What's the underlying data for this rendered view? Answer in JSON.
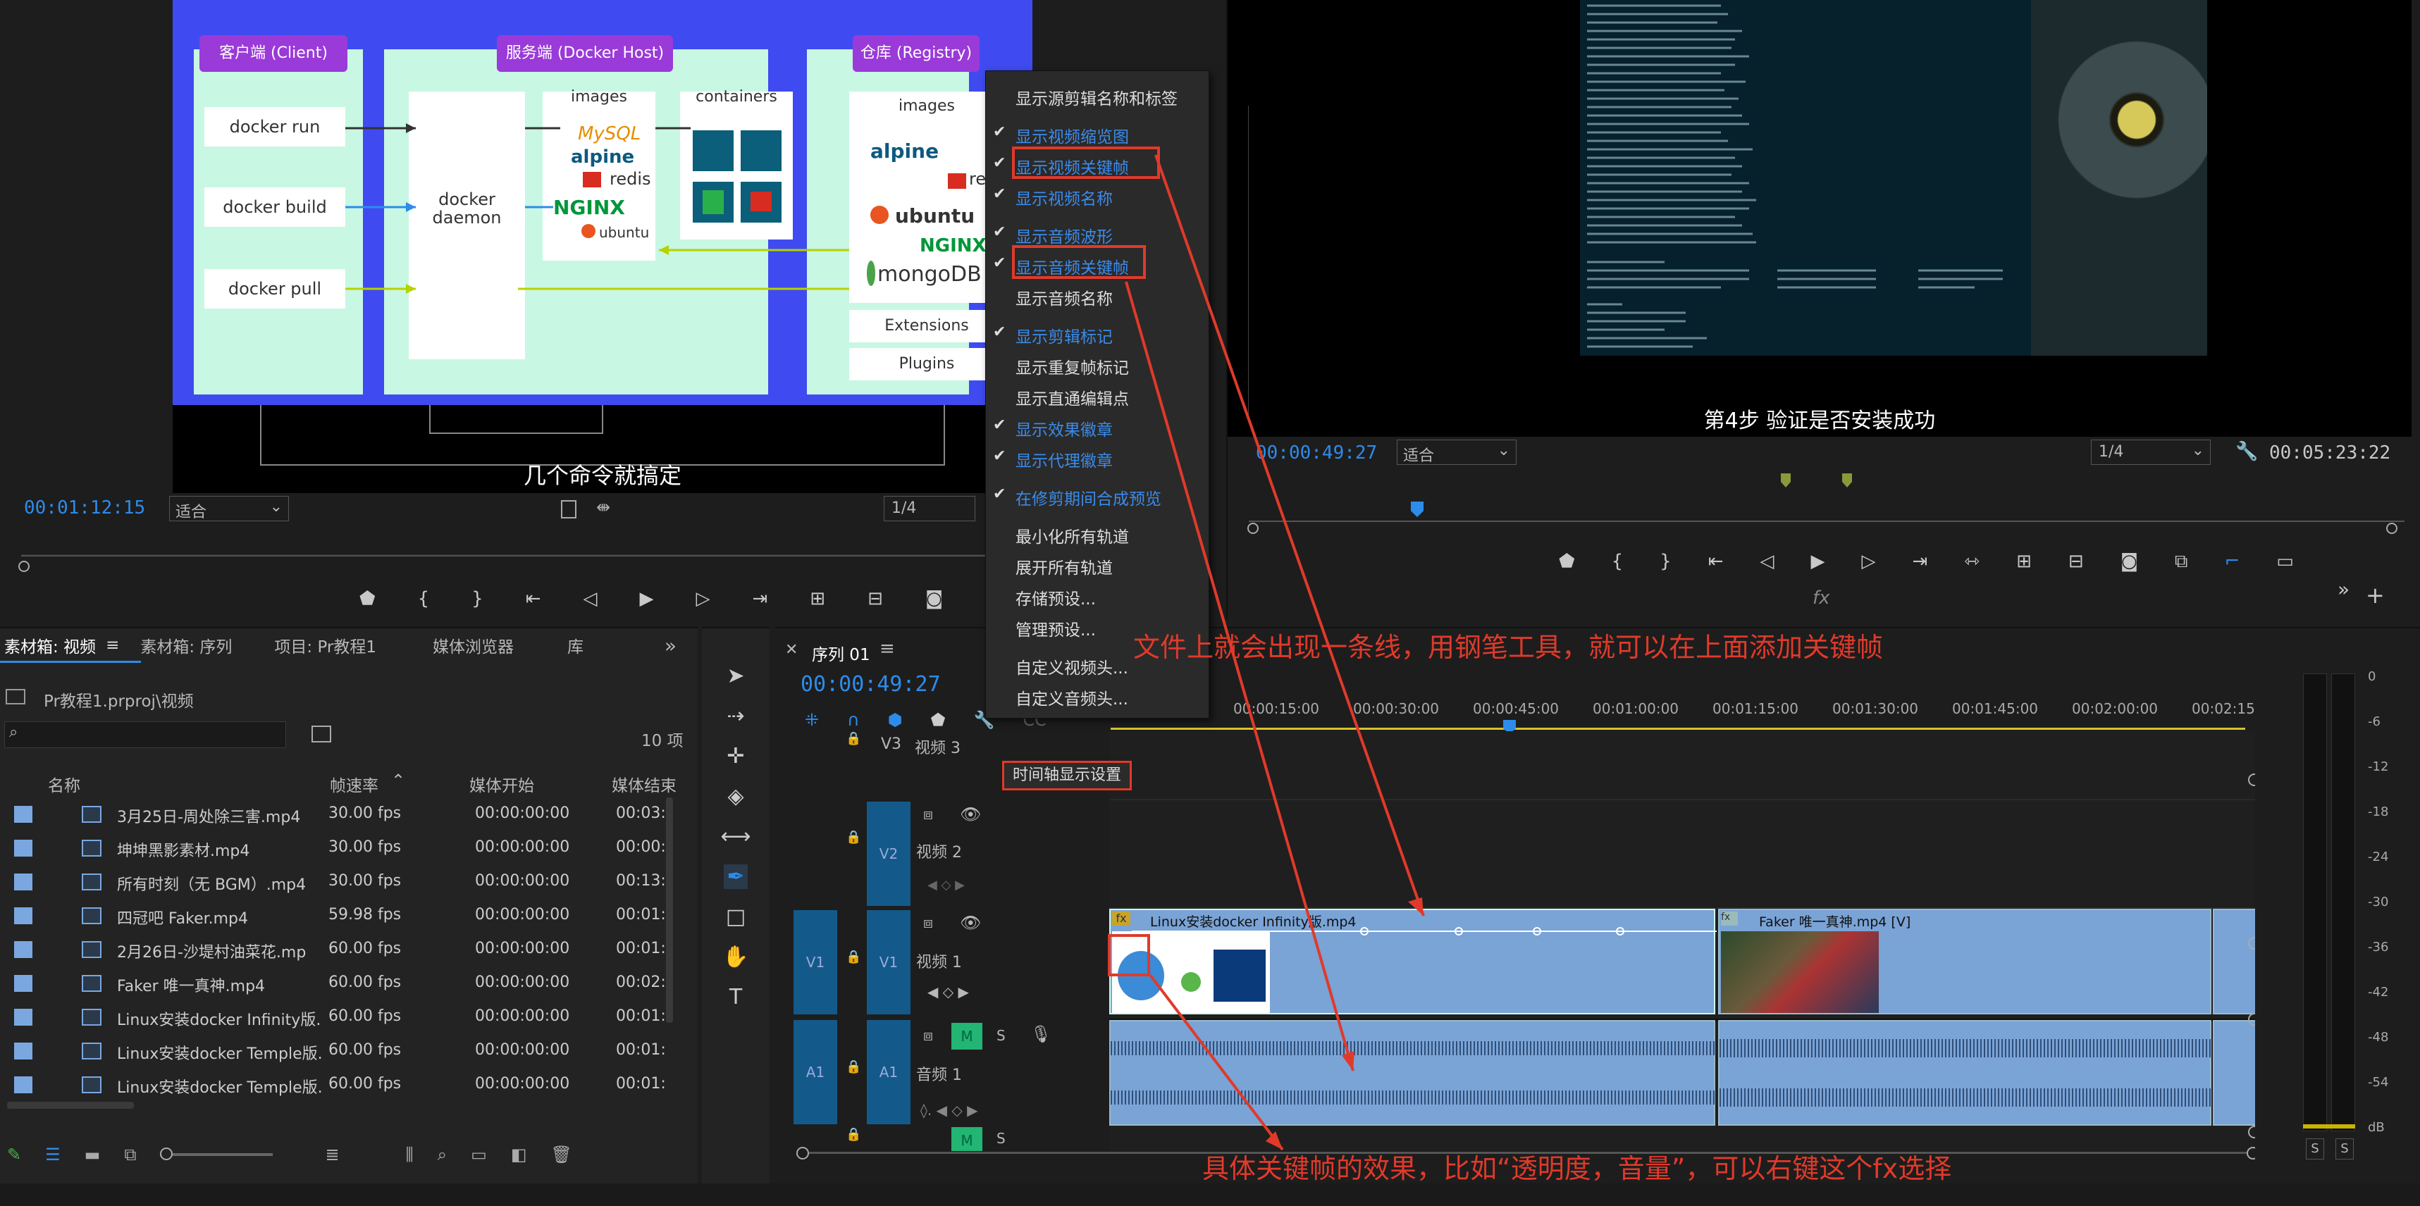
{
  "source_monitor": {
    "timecode": "00:01:12:15",
    "fit": "适合",
    "ratio": "1/4",
    "caption": "几个命令就搞定",
    "slide": {
      "client": "客户端 (Client)",
      "host": "服务端 (Docker Host)",
      "registry": "仓库 (Registry)",
      "cmds": [
        "docker run",
        "docker build",
        "docker pull"
      ],
      "daemon": "docker\ndaemon",
      "images": "images",
      "containers": "containers",
      "reg_images": "images",
      "logos_mid": [
        "MySQL",
        "alpine",
        "redis",
        "NGINX",
        "ubuntu"
      ],
      "logos_reg": [
        "alpine",
        "redis",
        "ubuntu",
        "NGINX",
        "mongoDB"
      ],
      "extensions": "Extensions",
      "plugins": "Plugins"
    }
  },
  "program_monitor": {
    "timecode": "00:00:49:27",
    "fit": "适合",
    "ratio": "1/4",
    "duration": "00:05:23:22",
    "caption": "第4步 验证是否安装成功",
    "fx": "fx"
  },
  "menu": {
    "items": [
      {
        "label": "显示源剪辑名称和标签",
        "checked": false
      },
      {
        "label": "显示视频缩览图",
        "checked": true
      },
      {
        "label": "显示视频关键帧",
        "checked": true,
        "highlight": true
      },
      {
        "label": "显示视频名称",
        "checked": true
      },
      {
        "label": "显示音频波形",
        "checked": true
      },
      {
        "label": "显示音频关键帧",
        "checked": true,
        "highlight": true
      },
      {
        "label": "显示音频名称",
        "checked": false
      },
      {
        "label": "显示剪辑标记",
        "checked": true
      },
      {
        "label": "显示重复帧标记",
        "checked": false
      },
      {
        "label": "显示直通编辑点",
        "checked": false
      },
      {
        "label": "显示效果徽章",
        "checked": true
      },
      {
        "label": "显示代理徽章",
        "checked": true
      },
      {
        "label": "在修剪期间合成预览",
        "checked": true
      },
      {
        "label": "最小化所有轨道",
        "checked": false
      },
      {
        "label": "展开所有轨道",
        "checked": false
      },
      {
        "label": "存储预设...",
        "checked": false
      },
      {
        "label": "管理预设...",
        "checked": false
      },
      {
        "label": "自定义视频头...",
        "checked": false
      },
      {
        "label": "自定义音频头...",
        "checked": false
      }
    ]
  },
  "project_panel": {
    "tabs": [
      "素材箱: 视频",
      "素材箱: 序列",
      "项目: Pr教程1",
      "媒体浏览器",
      "库"
    ],
    "path": "Pr教程1.prproj\\视频",
    "count": "10 项",
    "columns": [
      "名称",
      "帧速率",
      "媒体开始",
      "媒体结束"
    ],
    "rows": [
      {
        "name": "3月25日-周处除三害.mp4",
        "fps": "30.00 fps",
        "start": "00:00:00:00",
        "end": "00:03:"
      },
      {
        "name": "坤坤黑影素材.mp4",
        "fps": "30.00 fps",
        "start": "00:00:00:00",
        "end": "00:00:"
      },
      {
        "name": "所有时刻（无 BGM）.mp4",
        "fps": "30.00 fps",
        "start": "00:00:00:00",
        "end": "00:13:"
      },
      {
        "name": "四冠吧 Faker.mp4",
        "fps": "59.98 fps",
        "start": "00:00:00:00",
        "end": "00:01:"
      },
      {
        "name": "2月26日-沙堤村油菜花.mp",
        "fps": "60.00 fps",
        "start": "00:00:00:00",
        "end": "00:01:"
      },
      {
        "name": "Faker 唯一真神.mp4",
        "fps": "60.00 fps",
        "start": "00:00:00:00",
        "end": "00:02:"
      },
      {
        "name": "Linux安装docker Infinity版.",
        "fps": "60.00 fps",
        "start": "00:00:00:00",
        "end": "00:01:"
      },
      {
        "name": "Linux安装docker Temple版.",
        "fps": "60.00 fps",
        "start": "00:00:00:00",
        "end": "00:01:"
      },
      {
        "name": "Linux安装docker Temple版.",
        "fps": "60.00 fps",
        "start": "00:00:00:00",
        "end": "00:01:"
      }
    ]
  },
  "timeline": {
    "tab": "序列 01",
    "timecode": "00:00:49:27",
    "tooltip": "时间轴显示设置",
    "ruler": [
      "00:00",
      "00:00:15:00",
      "00:00:30:00",
      "00:00:45:00",
      "00:01:00:00",
      "00:01:15:00",
      "00:01:30:00",
      "00:01:45:00",
      "00:02:00:00",
      "00:02:15:00"
    ],
    "tracks": {
      "v3": {
        "code": "V3",
        "name": "视频 3"
      },
      "v2": {
        "code": "V2",
        "name": "视频 2",
        "src": ""
      },
      "v1": {
        "code": "V1",
        "name": "视频 1",
        "src": "V1"
      },
      "a1": {
        "code": "A1",
        "name": "音频 1",
        "src": "A1",
        "m": "M",
        "s": "S"
      },
      "a2": {
        "m": "M",
        "s": "S"
      }
    },
    "clips": {
      "v1a": "Linux安装docker Infinity版.mp4",
      "v1b": "Faker 唯一真神.mp4 [V]",
      "fx": "fx"
    }
  },
  "meter": {
    "scale": [
      "0",
      "-6",
      "-12",
      "-18",
      "-24",
      "-30",
      "-36",
      "-42",
      "-48",
      "-54",
      "dB"
    ],
    "solo": [
      "S",
      "S"
    ]
  },
  "annotations": {
    "top": "文件上就会出现一条线，用钢笔工具，就可以在上面添加关键帧",
    "bottom": "具体关键帧的效果，比如“透明度，音量”，可以右键这个fx选择"
  },
  "colors": {
    "timecode": "#2d8ceb",
    "clip": "#7aa3d6",
    "annotation": "#e03a2a",
    "menu_check": "#3b8bea"
  }
}
